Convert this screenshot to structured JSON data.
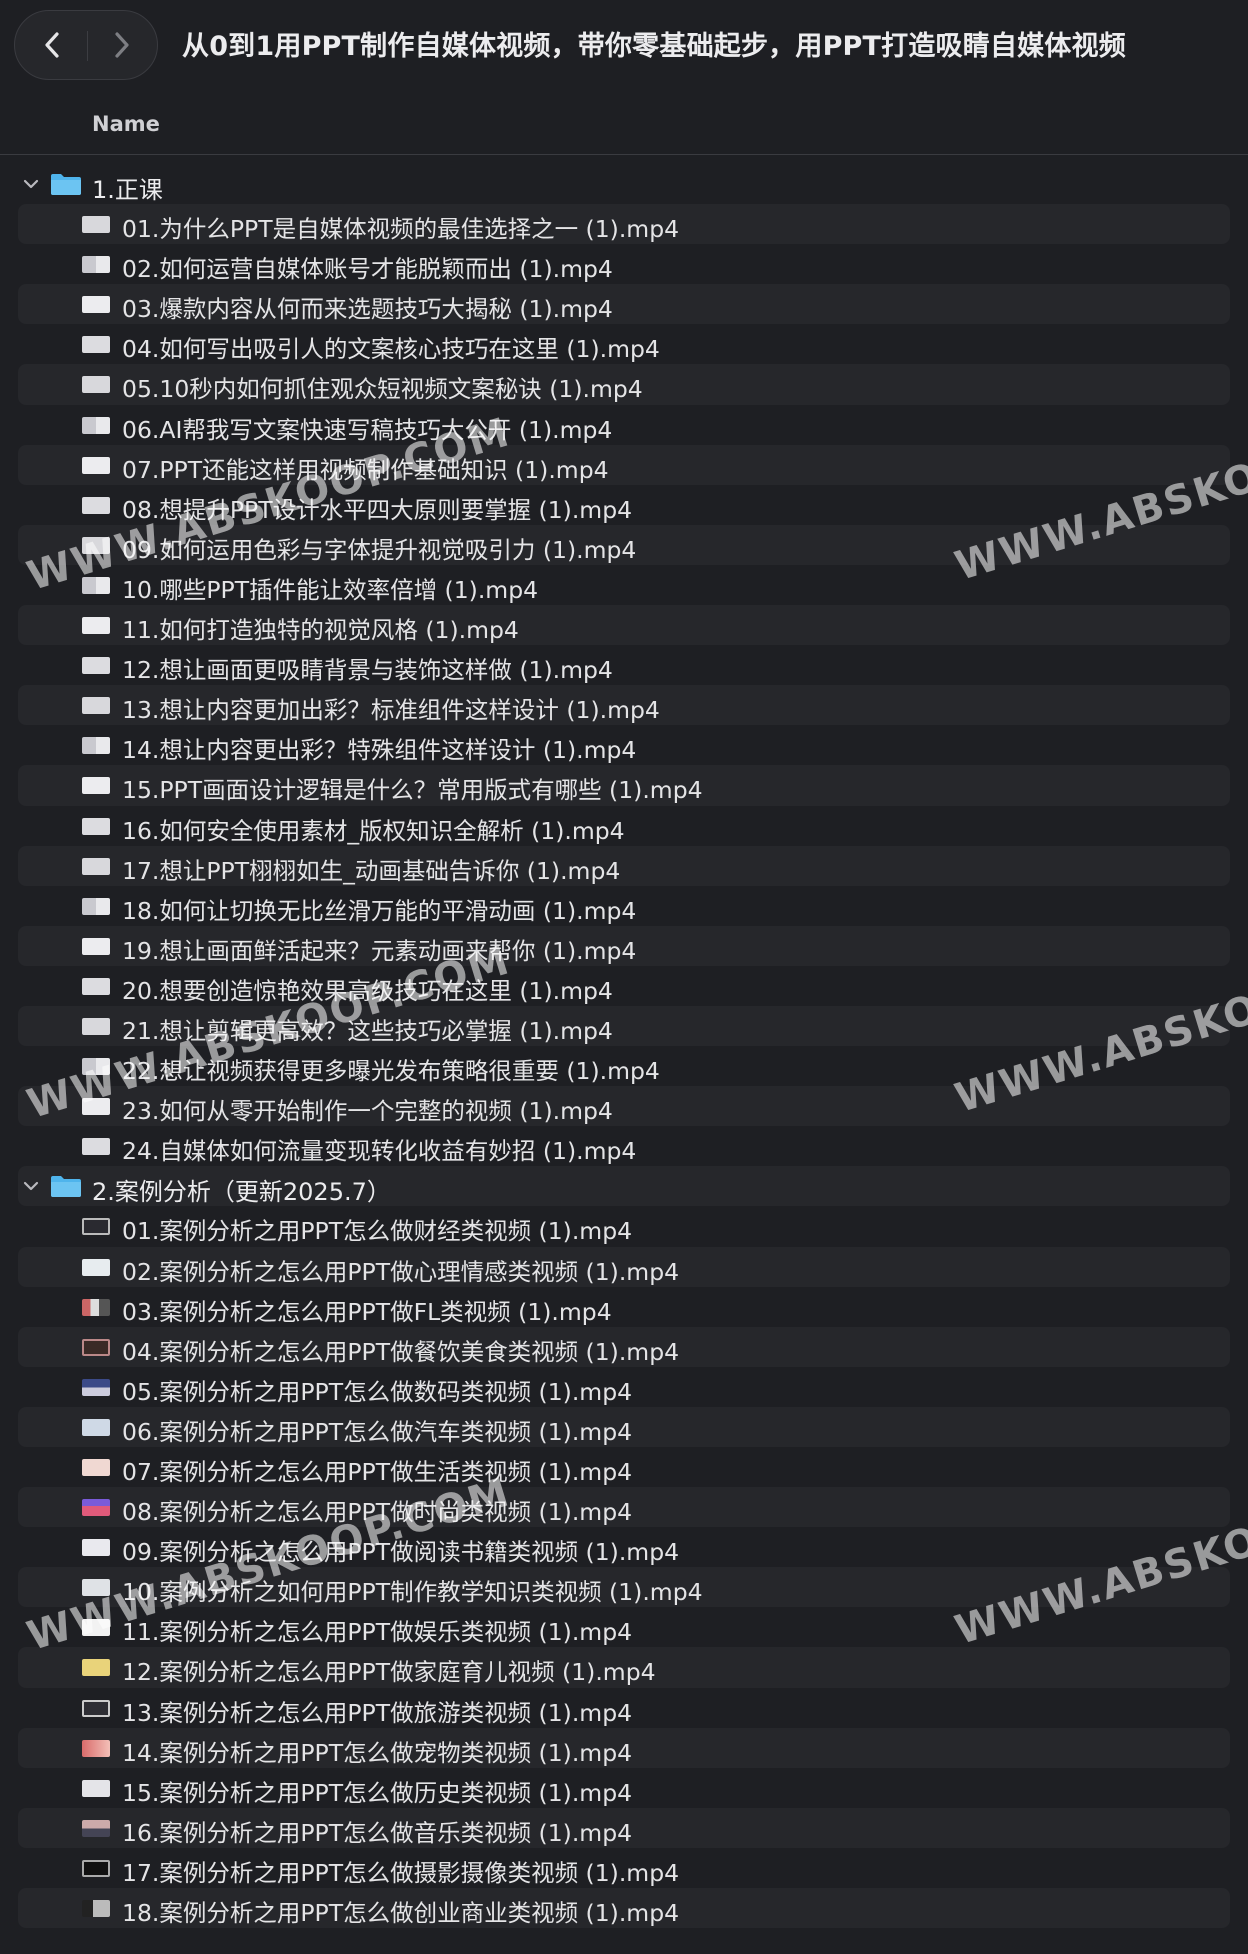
{
  "window": {
    "title": "从0到1用PPT制作自媒体视频，带你零基础起步，用PPT打造吸睛自媒体视频"
  },
  "header": {
    "name_column": "Name"
  },
  "folders": [
    {
      "label": "1.正课",
      "files": [
        "01.为什么PPT是自媒体视频的最佳选择之一 (1).mp4",
        "02.如何运营自媒体账号才能脱颖而出 (1).mp4",
        "03.爆款内容从何而来选题技巧大揭秘 (1).mp4",
        "04.如何写出吸引人的文案核心技巧在这里 (1).mp4",
        "05.10秒内如何抓住观众短视频文案秘诀 (1).mp4",
        "06.AI帮我写文案快速写稿技巧大公开 (1).mp4",
        "07.PPT还能这样用视频制作基础知识 (1).mp4",
        "08.想提升PPT设计水平四大原则要掌握 (1).mp4",
        "09.如何运用色彩与字体提升视觉吸引力 (1).mp4",
        "10.哪些PPT插件能让效率倍增 (1).mp4",
        "11.如何打造独特的视觉风格 (1).mp4",
        "12.想让画面更吸睛背景与装饰这样做 (1).mp4",
        "13.想让内容更加出彩？标准组件这样设计 (1).mp4",
        "14.想让内容更出彩？特殊组件这样设计 (1).mp4",
        "15.PPT画面设计逻辑是什么？常用版式有哪些 (1).mp4",
        "16.如何安全使用素材_版权知识全解析 (1).mp4",
        "17.想让PPT栩栩如生_动画基础告诉你 (1).mp4",
        "18.如何让切换无比丝滑万能的平滑动画 (1).mp4",
        "19.想让画面鲜活起来？元素动画来帮你 (1).mp4",
        "20.想要创造惊艳效果高级技巧在这里 (1).mp4",
        "21.想让剪辑更高效？这些技巧必掌握 (1).mp4",
        "22.想让视频获得更多曝光发布策略很重要 (1).mp4",
        "23.如何从零开始制作一个完整的视频 (1).mp4",
        "24.自媒体如何流量变现转化收益有妙招 (1).mp4"
      ]
    },
    {
      "label": "2.案例分析（更新2025.7）",
      "files": [
        "01.案例分析之用PPT怎么做财经类视频  (1).mp4",
        "02.案例分析之怎么用PPT做心理情感类视频  (1).mp4",
        "03.案例分析之怎么用PPT做FL类视频  (1).mp4",
        "04.案例分析之怎么用PPT做餐饮美食类视频  (1).mp4",
        "05.案例分析之用PPT怎么做数码类视频  (1).mp4",
        "06.案例分析之用PPT怎么做汽车类视频  (1).mp4",
        "07.案例分析之怎么用PPT做生活类视频  (1).mp4",
        "08.案例分析之怎么用PPT做时尚类视频  (1).mp4",
        "09.案例分析之怎么用PPT做阅读书籍类视频  (1).mp4",
        "10.案例分析之如何用PPT制作教学知识类视频  (1).mp4",
        "11.案例分析之怎么用PPT做娱乐类视频  (1).mp4",
        "12.案例分析之怎么用PPT做家庭育儿视频  (1).mp4",
        "13.案例分析之怎么用PPT做旅游类视频  (1).mp4",
        "14.案例分析之用PPT怎么做宠物类视频  (1).mp4",
        "15.案例分析之用PPT怎么做历史类视频  (1).mp4",
        "16.案例分析之用PPT怎么做音乐类视频  (1).mp4",
        "17.案例分析之用PPT怎么做摄影摄像类视频  (1).mp4",
        "18.案例分析之用PPT怎么做创业商业类视频  (1).mp4"
      ]
    }
  ],
  "watermark_text": "WWW.ABSKOOP.COM",
  "colors": {
    "background": "#1e1f23",
    "row_alt": "#26272b",
    "folder_blue": "#4fb4ec",
    "text": "#e4e4e6"
  }
}
